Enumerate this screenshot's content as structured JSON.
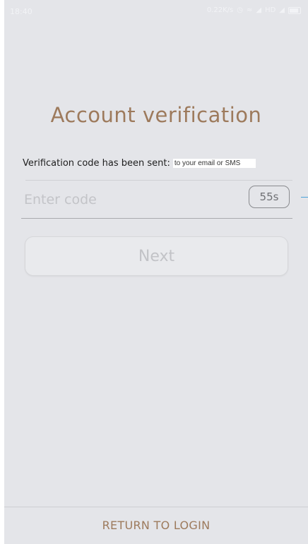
{
  "status_bar": {
    "time": "18:40",
    "speed": "0.22K/s",
    "network": "HD"
  },
  "page": {
    "title": "Account verification"
  },
  "verification": {
    "sent_label": "Verification code has been sent:",
    "sent_target": "to your email or SMS",
    "code_placeholder": "Enter code",
    "code_value": "",
    "countdown": "55s"
  },
  "actions": {
    "next_label": "Next",
    "return_label": "RETURN TO LOGIN"
  },
  "colors": {
    "background": "#e4e5e9",
    "accent": "#9d7a5c",
    "disabled_text": "#c2c3c7"
  }
}
